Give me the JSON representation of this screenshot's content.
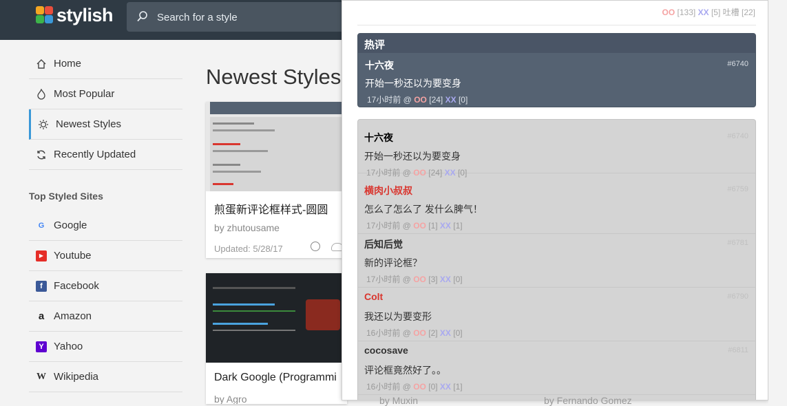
{
  "app": {
    "logo_text": "stylish"
  },
  "search": {
    "placeholder": "Search for a style"
  },
  "sidebar": {
    "nav": [
      {
        "label": "Home",
        "icon": "home-icon"
      },
      {
        "label": "Most Popular",
        "icon": "flame-icon"
      },
      {
        "label": "Newest Styles",
        "icon": "sparkle-icon"
      },
      {
        "label": "Recently Updated",
        "icon": "refresh-icon"
      }
    ],
    "top_sites_title": "Top Styled Sites",
    "sites": [
      {
        "label": "Google",
        "icon": "G",
        "color": "#4285f4"
      },
      {
        "label": "Youtube",
        "icon": "▶",
        "color": "#e52d27"
      },
      {
        "label": "Facebook",
        "icon": "f",
        "color": "#3b5998"
      },
      {
        "label": "Amazon",
        "icon": "a",
        "color": "#222222"
      },
      {
        "label": "Yahoo",
        "icon": "Y",
        "color": "#5f01d1"
      },
      {
        "label": "Wikipedia",
        "icon": "W",
        "color": "#333333"
      }
    ]
  },
  "main": {
    "title": "Newest Styles",
    "cards": [
      {
        "title": "煎蛋新评论框样式-圆圆",
        "author": "by zhutousame",
        "updated": "Updated: 5/28/17"
      },
      {
        "title": "Dark Google (Programmi",
        "author": "by Agro",
        "updated": ""
      }
    ],
    "below_cards": [
      "by Muxin",
      "by Fernando Gomez"
    ]
  },
  "popup": {
    "top_stats": {
      "oo": "OO",
      "oo_count": "[133]",
      "xx": "XX",
      "xx_count": "[5]",
      "label": "吐槽",
      "label_count": "[22]"
    },
    "hot": {
      "header": "热评",
      "name": "十六夜",
      "id": "#6740",
      "text": "开始一秒还以为要变身",
      "time": "17小时前  @",
      "oo": "OO",
      "oo_count": "[24]",
      "xx": "XX",
      "xx_count": "[0]"
    },
    "comments": [
      {
        "name": "十六夜",
        "name_color": "#333333",
        "id": "#6740",
        "text": "开始一秒还以为要变身",
        "time": "17小时前  @",
        "oo_count": "[24]",
        "xx_count": "[0]"
      },
      {
        "name": "横肉小叔叔",
        "name_color": "#d9362f",
        "id": "#6759",
        "text": "怎么了怎么了 发什么脾气！",
        "time": "17小时前  @",
        "oo_count": "[1]",
        "xx_count": "[1]"
      },
      {
        "name": "后知后觉",
        "name_color": "#333333",
        "id": "#6781",
        "text": "新的评论框？",
        "time": "17小时前  @",
        "oo_count": "[3]",
        "xx_count": "[0]"
      },
      {
        "name": "Colt",
        "name_color": "#d9362f",
        "id": "#6790",
        "text": "我还以为要变形",
        "time": "16小时前  @",
        "oo_count": "[2]",
        "xx_count": "[0]"
      },
      {
        "name": "cocosave",
        "name_color": "#333333",
        "id": "#6811",
        "text": "评论框竟然好了。。",
        "time": "16小时前  @",
        "oo_count": "[0]",
        "xx_count": "[1]"
      }
    ],
    "oo_label": "OO",
    "xx_label": "XX"
  },
  "colors": {
    "header_bg": "#2f3a44",
    "accent": "#3a98d8",
    "oo": "#f5a3a3",
    "xx": "#a9a9f0"
  }
}
